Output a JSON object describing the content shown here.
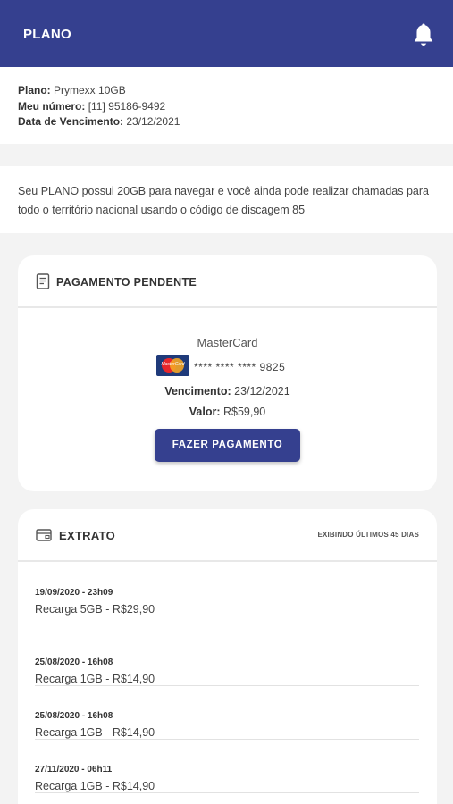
{
  "header": {
    "title": "PLANO",
    "bell_icon": "bell-icon"
  },
  "plan": {
    "plan_label": "Plano:",
    "plan_value": "Prymexx 10GB",
    "number_label": "Meu número:",
    "number_value": "[11] 95186-9492",
    "due_label": "Data de Vencimento:",
    "due_value": "23/12/2021"
  },
  "description": "Seu PLANO possui 20GB para navegar e você ainda pode realizar chamadas para todo o território nacional usando o código de discagem 85",
  "pending": {
    "title": "PAGAMENTO PENDENTE",
    "icon": "receipt-icon",
    "brand": "MasterCard",
    "logo_text": "MasterCard",
    "card_number": "**** **** **** 9825",
    "due_label": "Vencimento:",
    "due_value": "23/12/2021",
    "value_label": "Valor:",
    "value_value": "R$59,90",
    "button_label": "FAZER PAGAMENTO"
  },
  "extract": {
    "title": "EXTRATO",
    "icon": "wallet-icon",
    "subtitle": "EXIBINDO ÚLTIMOS 45 DIAS",
    "transactions": [
      {
        "date": "19/09/2020 - 23h09",
        "description": "Recarga 5GB - R$29,90"
      },
      {
        "date": "25/08/2020 - 16h08",
        "description": "Recarga 1GB - R$14,90"
      },
      {
        "date": "25/08/2020 - 16h08",
        "description": "Recarga 1GB - R$14,90"
      },
      {
        "date": "27/11/2020 - 06h11",
        "description": "Recarga 1GB - R$14,90"
      }
    ]
  },
  "colors": {
    "primary": "#35408f",
    "background": "#f3f3f3",
    "card": "#ffffff"
  }
}
